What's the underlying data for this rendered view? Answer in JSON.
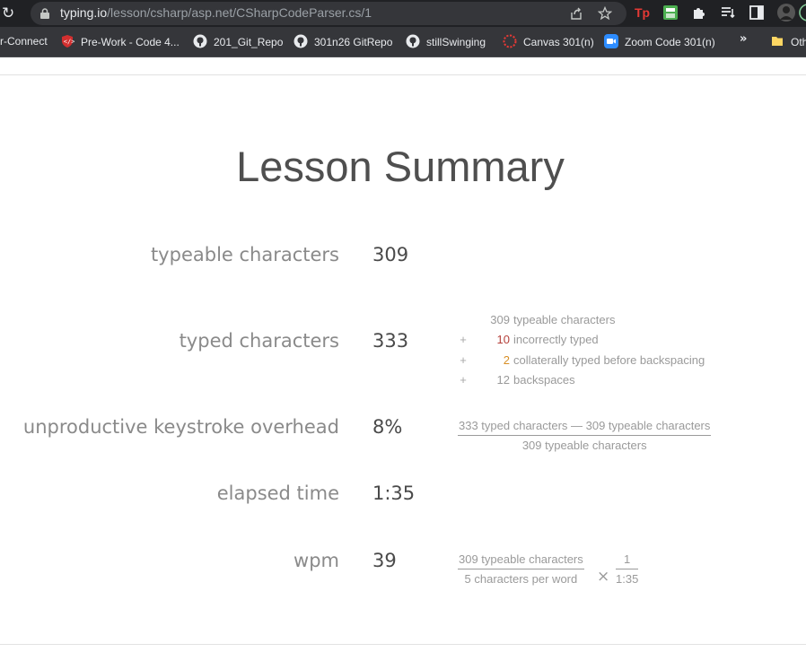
{
  "browser": {
    "url_host": "typing.io",
    "url_path": "/lesson/csharp/asp.net/CSharpCodeParser.cs/1",
    "bookmarks": [
      {
        "label": "r-Connect",
        "icon": "none"
      },
      {
        "label": "Pre-Work - Code 4...",
        "icon": "code-shield-icon"
      },
      {
        "label": "201_Git_Repo",
        "icon": "github-icon"
      },
      {
        "label": "301n26 GitRepo",
        "icon": "github-icon"
      },
      {
        "label": "stillSwinging",
        "icon": "github-icon"
      },
      {
        "label": "Canvas 301(n)",
        "icon": "canvas-icon"
      },
      {
        "label": "Zoom Code 301(n)",
        "icon": "zoom-icon"
      }
    ],
    "overflow_label": "»",
    "other_bookmarks_label": "Oth"
  },
  "page": {
    "title": "Lesson Summary",
    "rows": {
      "typeable": {
        "label": "typeable characters",
        "value": "309"
      },
      "typed": {
        "label": "typed characters",
        "value": "333"
      },
      "overhead": {
        "label": "unproductive keystroke overhead",
        "value": "8%"
      },
      "elapsed": {
        "label": "elapsed time",
        "value": "1:35"
      },
      "wpm": {
        "label": "wpm",
        "value": "39"
      }
    },
    "breakdown": [
      {
        "op": "",
        "num": "309",
        "text": "typeable characters"
      },
      {
        "op": "+",
        "num": "10",
        "text": "incorrectly typed"
      },
      {
        "op": "+",
        "num": "2",
        "text": "collaterally typed before backspacing"
      },
      {
        "op": "+",
        "num": "12",
        "text": "backspaces"
      }
    ],
    "overhead_formula": {
      "numerator": "333 typed characters — 309 typeable characters",
      "denominator": "309 typeable characters"
    },
    "wpm_formula": {
      "numerator1": "309 typeable characters",
      "denominator1": "5 characters per word",
      "times": "×",
      "numerator2": "1",
      "denominator2": "1:35"
    }
  },
  "colors": {
    "incorrect": "#b5403a",
    "collateral": "#d88f26"
  }
}
